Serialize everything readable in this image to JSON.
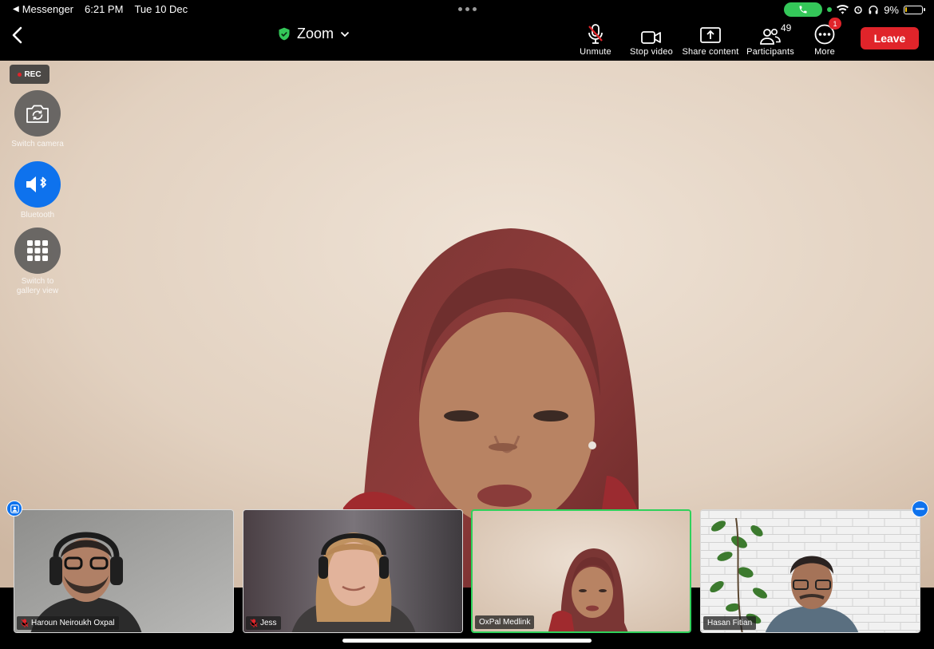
{
  "status_bar": {
    "back_app": "Messenger",
    "time": "6:21 PM",
    "date": "Tue 10 Dec",
    "battery": "9%",
    "battery_level": 0.09
  },
  "toolbar": {
    "title": "Zoom",
    "unmute_label": "Unmute",
    "stop_video_label": "Stop video",
    "share_label": "Share content",
    "participants_label": "Participants",
    "participants_count": "49",
    "more_label": "More",
    "more_badge": "1",
    "leave_label": "Leave"
  },
  "recording": {
    "label": "REC"
  },
  "side_controls": {
    "switch_camera": "Switch camera",
    "bluetooth": "Bluetooth",
    "gallery_line1": "Switch to",
    "gallery_line2": "gallery view"
  },
  "participants": [
    {
      "name": "Haroun Neiroukh Oxpal",
      "muted": true
    },
    {
      "name": "Jess",
      "muted": true
    },
    {
      "name": "OxPal Medlink",
      "muted": false,
      "active": true
    },
    {
      "name": "Hasan Fitian",
      "muted": false
    }
  ],
  "colors": {
    "leave": "#e0242a",
    "accent_blue": "#0e72ed",
    "active_speaker": "#2fd15b",
    "secure": "#34c759"
  }
}
